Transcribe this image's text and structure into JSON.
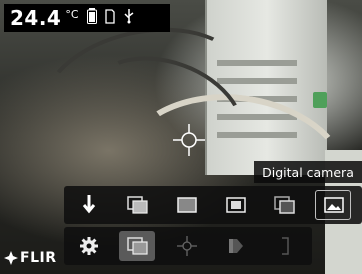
{
  "status_bar": {
    "temperature_value": "24.4",
    "temperature_unit": "°C",
    "icons": [
      "battery-icon",
      "sd-card-icon",
      "usb-icon"
    ]
  },
  "tooltip": {
    "text": "Digital camera"
  },
  "image_mode_menu": {
    "items": [
      {
        "name": "sort-arrow-icon",
        "selected": false
      },
      {
        "name": "thermal-msx-icon",
        "selected": false
      },
      {
        "name": "thermal-icon",
        "selected": false
      },
      {
        "name": "picture-in-picture-icon",
        "selected": false
      },
      {
        "name": "thermal-fusion-icon",
        "selected": false
      },
      {
        "name": "digital-camera-icon",
        "selected": true
      }
    ]
  },
  "main_menu": {
    "items": [
      {
        "name": "settings-gear-icon",
        "selected": false
      },
      {
        "name": "image-mode-icon",
        "selected": true
      },
      {
        "name": "measurement-icon",
        "selected": false
      },
      {
        "name": "color-palette-icon",
        "selected": false
      },
      {
        "name": "temperature-scale-icon",
        "selected": false
      }
    ]
  },
  "logo": {
    "text": "FLIR"
  },
  "colors": {
    "menu_bg": "#0f0f0f",
    "selected": "#5a5a5a",
    "text": "#ffffff"
  }
}
